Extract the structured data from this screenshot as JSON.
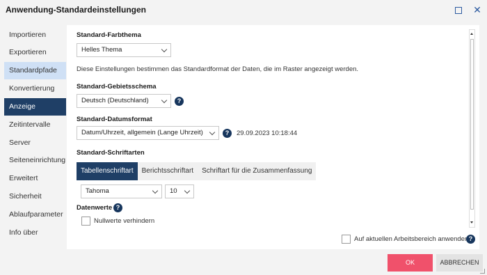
{
  "window": {
    "title": "Anwendung-Standardeinstellungen"
  },
  "sidebar": {
    "items": [
      {
        "label": "Importieren"
      },
      {
        "label": "Exportieren"
      },
      {
        "label": "Standardpfade"
      },
      {
        "label": "Konvertierung"
      },
      {
        "label": "Anzeige"
      },
      {
        "label": "Zeitintervalle"
      },
      {
        "label": "Server"
      },
      {
        "label": "Seiteneinrichtung"
      },
      {
        "label": "Erweitert"
      },
      {
        "label": "Sicherheit"
      },
      {
        "label": "Ablaufparameter"
      },
      {
        "label": "Info über"
      }
    ]
  },
  "content": {
    "theme": {
      "label": "Standard-Farbthema",
      "value": "Helles Thema"
    },
    "info_text": "Diese Einstellungen bestimmen das Standardformat der Daten, die im Raster angezeigt werden.",
    "locale": {
      "label": "Standard-Gebietsschema",
      "value": "Deutsch (Deutschland)"
    },
    "date_format": {
      "label": "Standard-Datumsformat",
      "value": "Datum/Uhrzeit, allgemein (Lange Uhrzeit)",
      "preview": "29.09.2023 10:18:44"
    },
    "fonts": {
      "label": "Standard-Schriftarten",
      "tabs": [
        {
          "label": "Tabellenschriftart"
        },
        {
          "label": "Berichtsschriftart"
        },
        {
          "label": "Schriftart für die Zusammenfassung"
        }
      ],
      "font_value": "Tahoma",
      "size_value": "10"
    },
    "data_values": {
      "label": "Datenwerte",
      "prevent_nulls_label": "Nullwerte verhindern"
    }
  },
  "footer": {
    "apply_workspace_label": "Auf aktuellen Arbeitsbereich anwenden",
    "ok_label": "OK",
    "cancel_label": "ABBRECHEN"
  },
  "help_symbol": "?",
  "close_symbol": "✕",
  "colors": {
    "accent": "#1f3f66",
    "highlight": "#cfe0f5",
    "ok": "#f0516b",
    "help": "#17365d"
  }
}
